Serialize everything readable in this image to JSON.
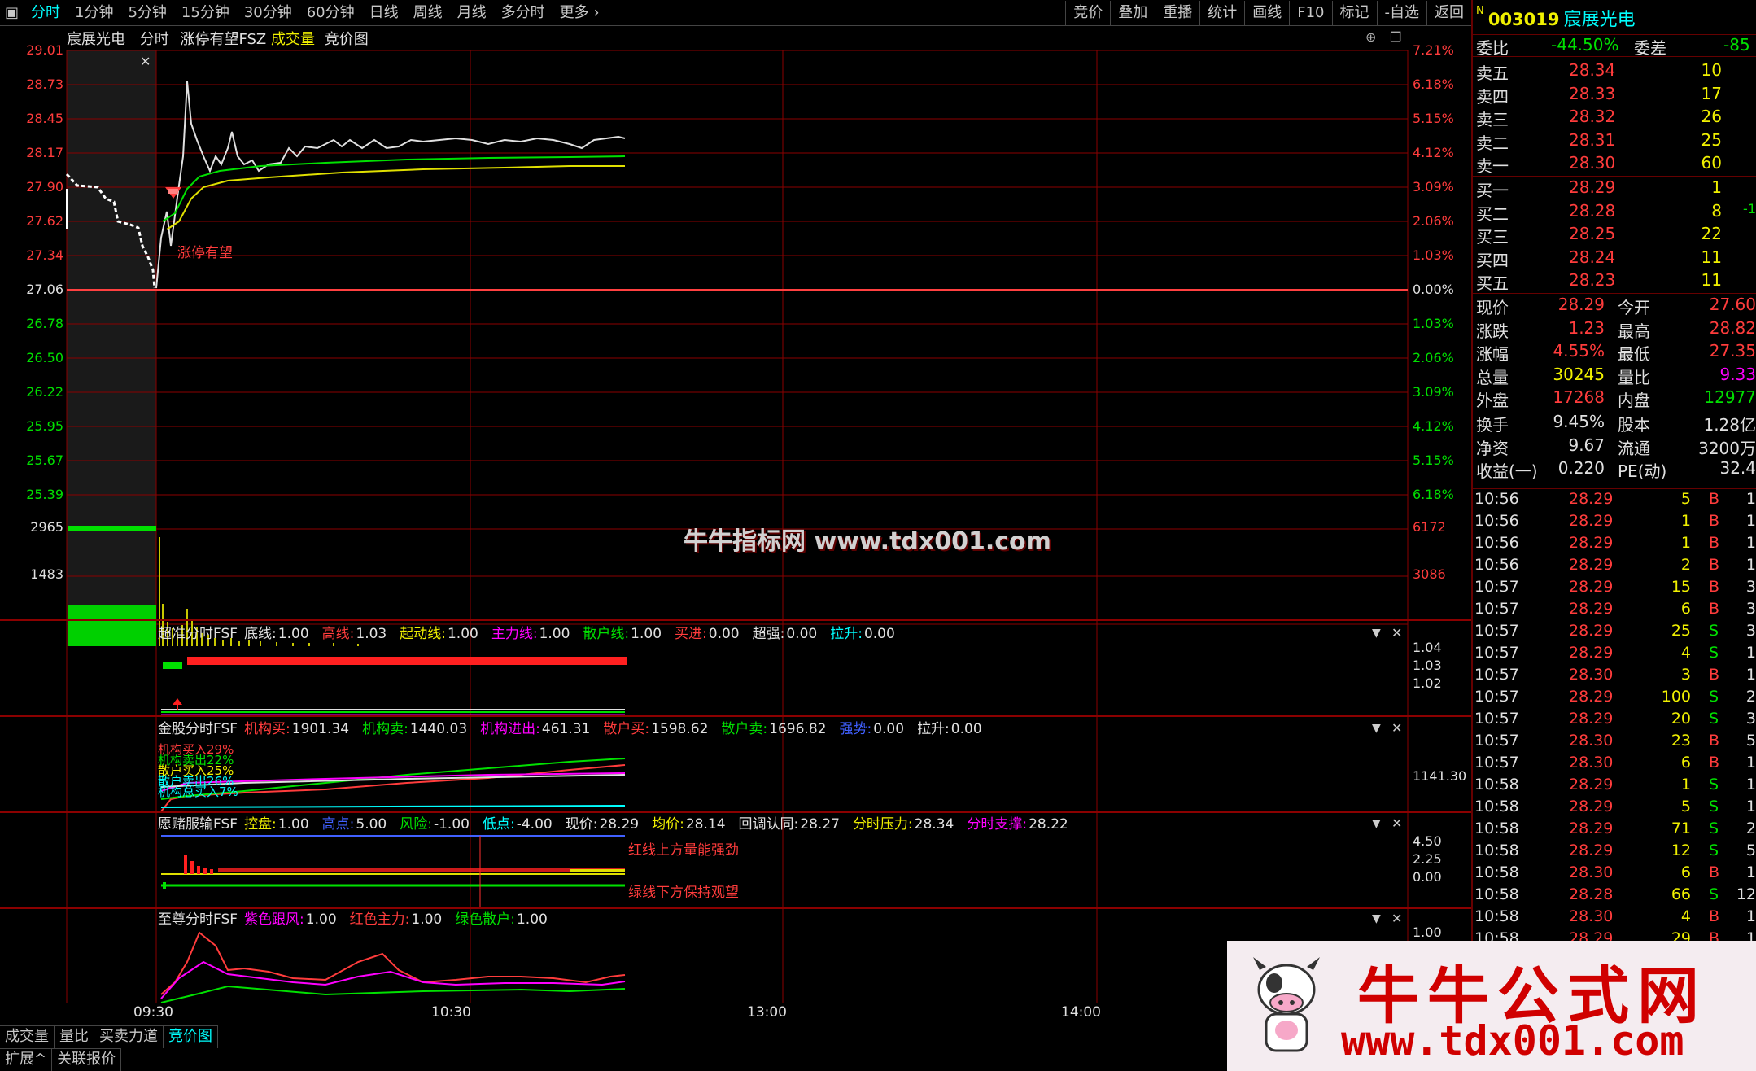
{
  "toolbar": {
    "periods": [
      "分时",
      "1分钟",
      "5分钟",
      "15分钟",
      "30分钟",
      "60分钟",
      "日线",
      "周线",
      "月线",
      "多分时",
      "更多"
    ],
    "right": [
      "竞价",
      "叠加",
      "重播",
      "统计",
      "画线",
      "F10",
      "标记",
      "-自选",
      "返回"
    ]
  },
  "chart_header": {
    "name": "宸展光电",
    "mode": "分时",
    "indicator": "涨停有望FSZ",
    "volume": "成交量",
    "auction": "竞价图"
  },
  "price_axis": {
    "left": [
      "29.01",
      "28.73",
      "28.45",
      "28.17",
      "27.90",
      "27.62",
      "27.34",
      "27.06",
      "26.78",
      "26.50",
      "26.22",
      "25.95",
      "25.67",
      "25.39"
    ],
    "right": [
      "7.21%",
      "6.18%",
      "5.15%",
      "4.12%",
      "3.09%",
      "2.06%",
      "1.03%",
      "0.00%",
      "1.03%",
      "2.06%",
      "3.09%",
      "4.12%",
      "5.15%",
      "6.18%"
    ]
  },
  "volume_axis": {
    "left": [
      "2965",
      "1483"
    ],
    "right": [
      "6172",
      "3086"
    ]
  },
  "signal_label": "涨停有望",
  "watermark_center": "牛牛指标网 www.tdx001.com",
  "time_axis": [
    "09:30",
    "10:30",
    "13:00",
    "14:00"
  ],
  "ind1": {
    "name": "超准分时FSF",
    "items": [
      {
        "k": "底线:",
        "v": "1.00",
        "c": "wht"
      },
      {
        "k": "高线:",
        "v": "1.03",
        "c": "red"
      },
      {
        "k": "起动线:",
        "v": "1.00",
        "c": "yel"
      },
      {
        "k": "主力线:",
        "v": "1.00",
        "c": "mag"
      },
      {
        "k": "散户线:",
        "v": "1.00",
        "c": "grn"
      },
      {
        "k": "买进:",
        "v": "0.00",
        "c": "red"
      },
      {
        "k": "超强:",
        "v": "0.00",
        "c": "wht"
      },
      {
        "k": "拉升:",
        "v": "0.00",
        "c": "cyn"
      }
    ],
    "axis": [
      "1.04",
      "1.03",
      "1.02"
    ]
  },
  "ind2": {
    "name": "金股分时FSF",
    "items": [
      {
        "k": "机构买:",
        "v": "1901.34",
        "c": "red"
      },
      {
        "k": "机构卖:",
        "v": "1440.03",
        "c": "grn"
      },
      {
        "k": "机构进出:",
        "v": "461.31",
        "c": "mag"
      },
      {
        "k": "散户买:",
        "v": "1598.62",
        "c": "red"
      },
      {
        "k": "散户卖:",
        "v": "1696.82",
        "c": "grn"
      },
      {
        "k": "强势:",
        "v": "0.00",
        "c": "blu"
      },
      {
        "k": "拉升:",
        "v": "0.00",
        "c": "wht"
      }
    ],
    "axis": [
      "1141.30"
    ],
    "overlay": [
      "机构买入29%",
      "机构卖出22%",
      "散户买入25%",
      "散户卖出26%",
      "机构总买入7%"
    ]
  },
  "ind3": {
    "name": "愿赌服输FSF",
    "items": [
      {
        "k": "控盘:",
        "v": "1.00",
        "c": "yel"
      },
      {
        "k": "高点:",
        "v": "5.00",
        "c": "blu"
      },
      {
        "k": "风险:",
        "v": "-1.00",
        "c": "grn"
      },
      {
        "k": "低点:",
        "v": "-4.00",
        "c": "cyn"
      },
      {
        "k": "现价:",
        "v": "28.29",
        "c": "wht"
      },
      {
        "k": "均价:",
        "v": "28.14",
        "c": "yel"
      },
      {
        "k": "回调认同:",
        "v": "28.27",
        "c": "wht"
      },
      {
        "k": "分时压力:",
        "v": "28.34",
        "c": "yel"
      },
      {
        "k": "分时支撑:",
        "v": "28.22",
        "c": "mag"
      }
    ],
    "axis": [
      "4.50",
      "2.25",
      "0.00"
    ],
    "notes": [
      "红线上方量能强劲",
      "绿线下方保持观望"
    ]
  },
  "ind4": {
    "name": "至尊分时FSF",
    "items": [
      {
        "k": "紫色跟风:",
        "v": "1.00",
        "c": "mag"
      },
      {
        "k": "红色主力:",
        "v": "1.00",
        "c": "red"
      },
      {
        "k": "绿色散户:",
        "v": "1.00",
        "c": "grn"
      }
    ],
    "axis": [
      "1.00"
    ]
  },
  "bottom_tabs": [
    "成交量",
    "量比",
    "买卖力道",
    "竞价图"
  ],
  "bottom_tabs2": [
    "扩展^",
    "关联报价"
  ],
  "quote": {
    "code": "003019",
    "name": "宸展光电",
    "flag": "N",
    "weibi_label": "委比",
    "weibi": "-44.50%",
    "weicha_label": "委差",
    "weicha": "-85",
    "asks": [
      {
        "l": "卖五",
        "p": "28.34",
        "v": "10"
      },
      {
        "l": "卖四",
        "p": "28.33",
        "v": "17"
      },
      {
        "l": "卖三",
        "p": "28.32",
        "v": "26"
      },
      {
        "l": "卖二",
        "p": "28.31",
        "v": "25"
      },
      {
        "l": "卖一",
        "p": "28.30",
        "v": "60"
      }
    ],
    "bids": [
      {
        "l": "买一",
        "p": "28.29",
        "v": "1",
        "x": ""
      },
      {
        "l": "买二",
        "p": "28.28",
        "v": "8",
        "x": "-1"
      },
      {
        "l": "买三",
        "p": "28.25",
        "v": "22",
        "x": ""
      },
      {
        "l": "买四",
        "p": "28.24",
        "v": "11",
        "x": ""
      },
      {
        "l": "买五",
        "p": "28.23",
        "v": "11",
        "x": ""
      }
    ],
    "stats1": [
      {
        "a": "现价",
        "av": "28.29",
        "ac": "red",
        "b": "今开",
        "bv": "27.60",
        "bc": "red"
      },
      {
        "a": "涨跌",
        "av": "1.23",
        "ac": "red",
        "b": "最高",
        "bv": "28.82",
        "bc": "red"
      },
      {
        "a": "涨幅",
        "av": "4.55%",
        "ac": "red",
        "b": "最低",
        "bv": "27.35",
        "bc": "red"
      },
      {
        "a": "总量",
        "av": "30245",
        "ac": "yel",
        "b": "量比",
        "bv": "9.33",
        "bc": "mag"
      },
      {
        "a": "外盘",
        "av": "17268",
        "ac": "red",
        "b": "内盘",
        "bv": "12977",
        "bc": "grn"
      }
    ],
    "stats2": [
      {
        "a": "换手",
        "av": "9.45%",
        "ac": "wht",
        "b": "股本",
        "bv": "1.28亿",
        "bc": "wht"
      },
      {
        "a": "净资",
        "av": "9.67",
        "ac": "wht",
        "b": "流通",
        "bv": "3200万",
        "bc": "wht"
      },
      {
        "a": "收益(一)",
        "av": "0.220",
        "ac": "wht",
        "b": "PE(动)",
        "bv": "32.4",
        "bc": "wht"
      }
    ],
    "ticks": [
      {
        "t": "10:56",
        "p": "28.29",
        "v": "5",
        "d": "B",
        "n": "1"
      },
      {
        "t": "10:56",
        "p": "28.29",
        "v": "1",
        "d": "B",
        "n": "1"
      },
      {
        "t": "10:56",
        "p": "28.29",
        "v": "1",
        "d": "B",
        "n": "1"
      },
      {
        "t": "10:56",
        "p": "28.29",
        "v": "2",
        "d": "B",
        "n": "1"
      },
      {
        "t": "10:57",
        "p": "28.29",
        "v": "15",
        "d": "B",
        "n": "3"
      },
      {
        "t": "10:57",
        "p": "28.29",
        "v": "6",
        "d": "B",
        "n": "3"
      },
      {
        "t": "10:57",
        "p": "28.29",
        "v": "25",
        "d": "S",
        "n": "3"
      },
      {
        "t": "10:57",
        "p": "28.29",
        "v": "4",
        "d": "S",
        "n": "1"
      },
      {
        "t": "10:57",
        "p": "28.30",
        "v": "3",
        "d": "B",
        "n": "1"
      },
      {
        "t": "10:57",
        "p": "28.29",
        "v": "100",
        "d": "S",
        "n": "2"
      },
      {
        "t": "10:57",
        "p": "28.29",
        "v": "20",
        "d": "S",
        "n": "3"
      },
      {
        "t": "10:57",
        "p": "28.30",
        "v": "23",
        "d": "B",
        "n": "5"
      },
      {
        "t": "10:57",
        "p": "28.30",
        "v": "6",
        "d": "B",
        "n": "1"
      },
      {
        "t": "10:58",
        "p": "28.29",
        "v": "1",
        "d": "S",
        "n": "1"
      },
      {
        "t": "10:58",
        "p": "28.29",
        "v": "5",
        "d": "S",
        "n": "1"
      },
      {
        "t": "10:58",
        "p": "28.29",
        "v": "71",
        "d": "S",
        "n": "2"
      },
      {
        "t": "10:58",
        "p": "28.29",
        "v": "12",
        "d": "S",
        "n": "5"
      },
      {
        "t": "10:58",
        "p": "28.30",
        "v": "6",
        "d": "B",
        "n": "1"
      },
      {
        "t": "10:58",
        "p": "28.28",
        "v": "66",
        "d": "S",
        "n": "12"
      },
      {
        "t": "10:58",
        "p": "28.30",
        "v": "4",
        "d": "B",
        "n": "1"
      },
      {
        "t": "10:58",
        "p": "28.29",
        "v": "29",
        "d": "B",
        "n": "1"
      }
    ]
  },
  "ad_banner": {
    "title": "牛牛公式网",
    "url": "www.tdx001.com"
  },
  "colors": {
    "up": "#ff3c3c",
    "down": "#00e000",
    "grid": "#8b0000",
    "bg": "#000000"
  }
}
